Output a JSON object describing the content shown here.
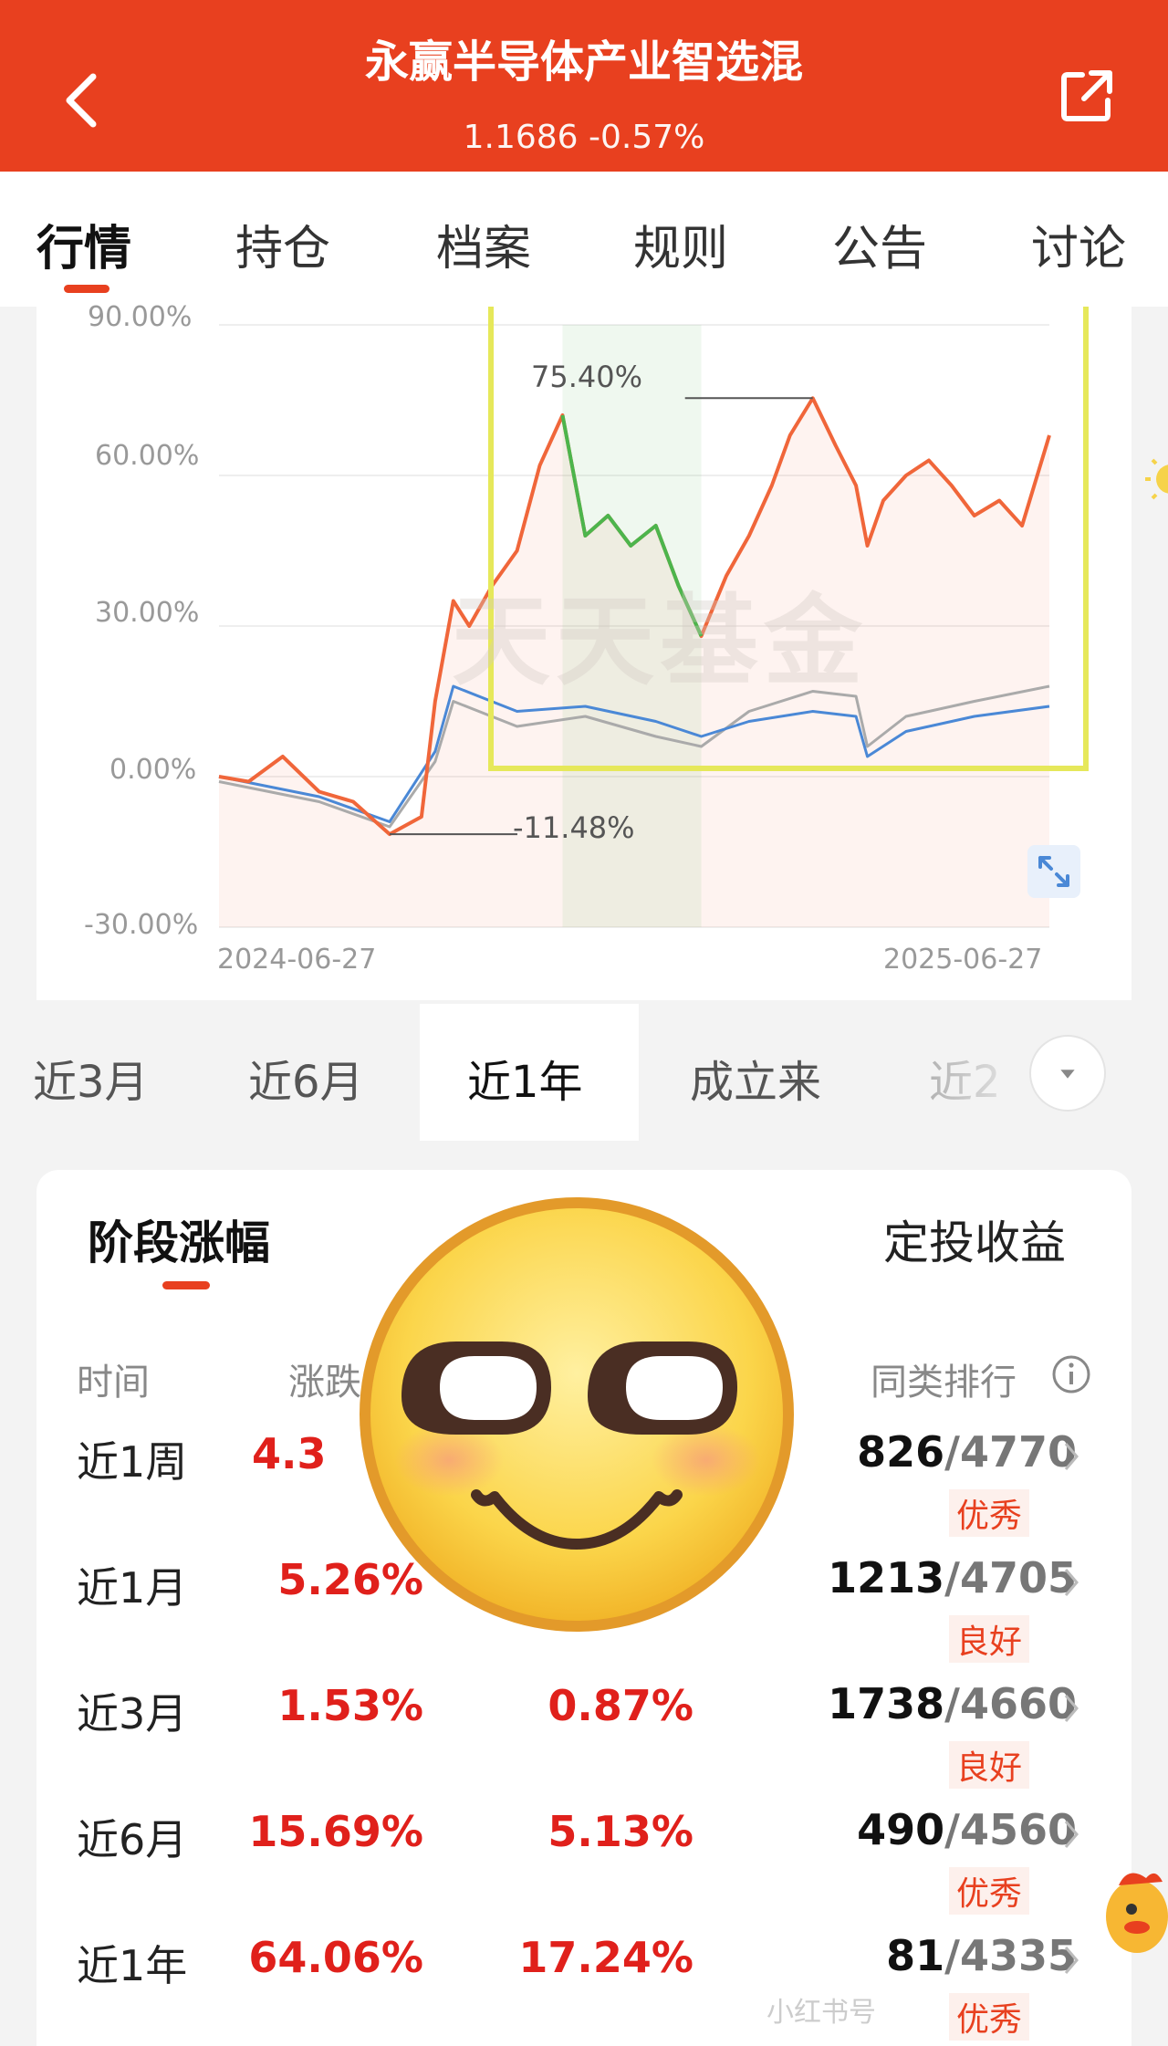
{
  "header": {
    "title": "永赢半导体产业智选混",
    "price_change": "1.1686 -0.57%",
    "color": "#e8401f"
  },
  "tabs": {
    "items": [
      "行情",
      "持仓",
      "档案",
      "规则",
      "公告",
      "讨论"
    ],
    "active": "行情"
  },
  "chart": {
    "watermark": "天天基金",
    "y_ticks": [
      "90.00%",
      "60.00%",
      "30.00%",
      "0.00%",
      "-30.00%"
    ],
    "x_labels": [
      "2024-06-27",
      "2025-06-27"
    ],
    "annotation_max": "75.40%",
    "annotation_min": "-11.48%"
  },
  "chart_data": {
    "type": "line",
    "x_range": [
      "2024-06-27",
      "2025-06-27"
    ],
    "ylim": [
      -30,
      90
    ],
    "y_unit": "%",
    "grid": true,
    "highlight_max": 75.4,
    "highlight_min": -11.48,
    "series": [
      {
        "color": "#f0663a",
        "x": [
          "2024-06-27",
          "2024-07-10",
          "2024-07-25",
          "2024-08-10",
          "2024-08-25",
          "2024-09-10",
          "2024-09-24",
          "2024-09-30",
          "2024-10-08",
          "2024-10-15",
          "2024-10-25",
          "2024-11-05",
          "2024-11-15",
          "2024-11-25",
          "2024-12-05",
          "2024-12-15",
          "2024-12-25",
          "2025-01-05",
          "2025-01-15",
          "2025-01-25",
          "2025-02-05",
          "2025-02-15",
          "2025-02-25",
          "2025-03-05",
          "2025-03-15",
          "2025-03-25",
          "2025-04-03",
          "2025-04-08",
          "2025-04-15",
          "2025-04-25",
          "2025-05-05",
          "2025-05-15",
          "2025-05-25",
          "2025-06-05",
          "2025-06-15",
          "2025-06-27"
        ],
        "values": [
          0,
          -1,
          4,
          -3,
          -5,
          -11.48,
          -8,
          15,
          35,
          30,
          38,
          45,
          62,
          72,
          48,
          52,
          46,
          50,
          38,
          28,
          40,
          48,
          58,
          68,
          75.4,
          66,
          58,
          46,
          55,
          60,
          63,
          58,
          52,
          55,
          50,
          68
        ]
      },
      {
        "color": "#4a88d6",
        "x": [
          "2024-06-27",
          "2024-08-10",
          "2024-09-10",
          "2024-09-30",
          "2024-10-08",
          "2024-11-05",
          "2024-12-05",
          "2025-01-05",
          "2025-01-25",
          "2025-02-15",
          "2025-03-15",
          "2025-04-03",
          "2025-04-08",
          "2025-04-25",
          "2025-05-25",
          "2025-06-27"
        ],
        "values": [
          0,
          -4,
          -9,
          5,
          18,
          13,
          14,
          11,
          8,
          11,
          13,
          12,
          4,
          9,
          12,
          14
        ]
      },
      {
        "color": "#aaaaaa",
        "x": [
          "2024-06-27",
          "2024-08-10",
          "2024-09-10",
          "2024-09-30",
          "2024-10-08",
          "2024-11-05",
          "2024-12-05",
          "2025-01-05",
          "2025-01-25",
          "2025-02-15",
          "2025-03-15",
          "2025-04-03",
          "2025-04-08",
          "2025-04-25",
          "2025-05-25",
          "2025-06-27"
        ],
        "values": [
          -1,
          -5,
          -10,
          3,
          15,
          10,
          12,
          8,
          6,
          13,
          17,
          16,
          6,
          12,
          15,
          18
        ]
      }
    ]
  },
  "periods": {
    "items": [
      "近3月",
      "近6月",
      "近1年",
      "成立来",
      "近2"
    ],
    "active": "近1年"
  },
  "performance": {
    "title": "阶段涨幅",
    "right_title": "定投收益",
    "headers": {
      "time": "时间",
      "change": "涨跌",
      "rank": "同类排行"
    },
    "rows": [
      {
        "period": "近1周",
        "fund": "4.3",
        "bench": "",
        "rank": "826",
        "total": "/4770",
        "rating": "优秀"
      },
      {
        "period": "近1月",
        "fund": "5.26%",
        "bench": "",
        "rank": "1213",
        "total": "/4705",
        "rating": "良好"
      },
      {
        "period": "近3月",
        "fund": "1.53%",
        "bench": "0.87%",
        "rank": "1738",
        "total": "/4660",
        "rating": "良好"
      },
      {
        "period": "近6月",
        "fund": "15.69%",
        "bench": "5.13%",
        "rank": "490",
        "total": "/4560",
        "rating": "优秀"
      },
      {
        "period": "近1年",
        "fund": "64.06%",
        "bench": "17.24%",
        "rank": "81",
        "total": "/4335",
        "rating": "优秀"
      }
    ]
  },
  "overlay": {
    "watermark_text": "小红书号"
  }
}
